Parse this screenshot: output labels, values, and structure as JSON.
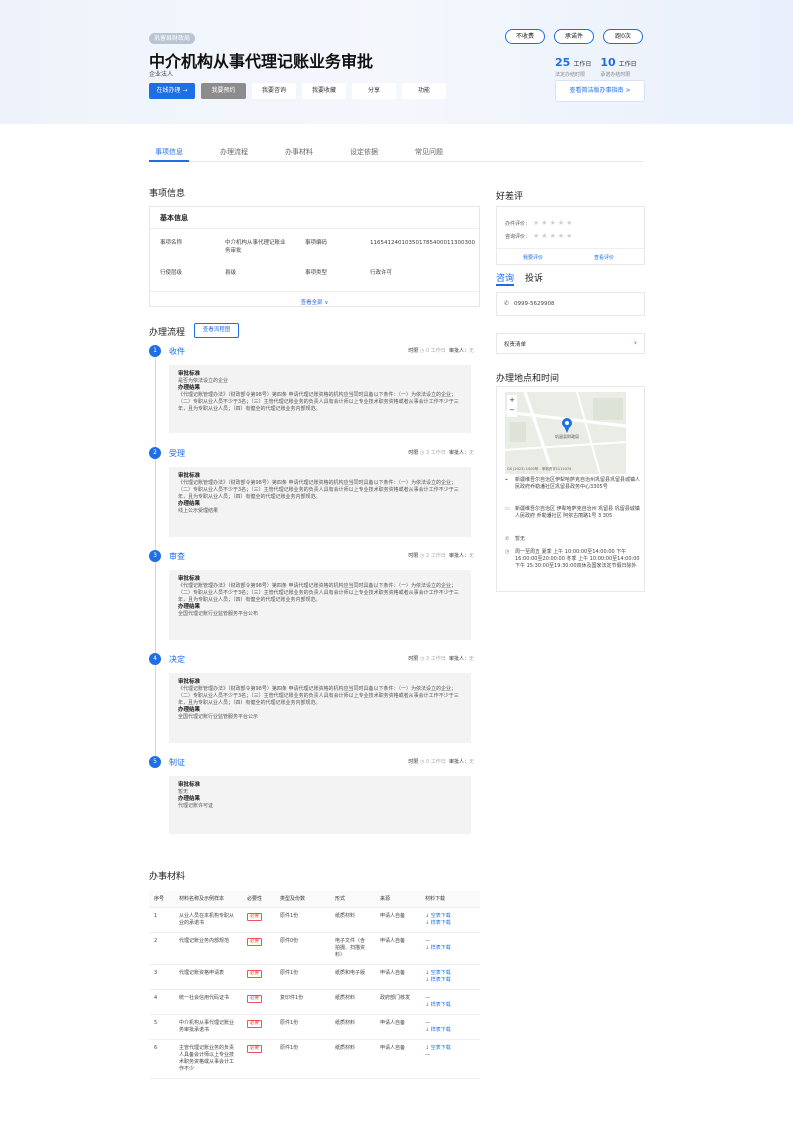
{
  "header": {
    "department": "巩留县财政局",
    "title": "中介机构从事代理记账业务审批",
    "service_object": "企业法人",
    "buttons": [
      "在线办理 →",
      "我要预约",
      "我要咨询",
      "我要收藏",
      "分享",
      "功能"
    ],
    "badges": [
      "不收费",
      "承诺件",
      "跑0次"
    ],
    "stats": [
      {
        "number": "25",
        "unit": "工作日",
        "label": "法定办结时限"
      },
      {
        "number": "10",
        "unit": "工作日",
        "label": "承诺办结时限"
      }
    ],
    "guide_link": "查看简洁版办事指南 >"
  },
  "tabs": [
    "事项信息",
    "办理流程",
    "办事材料",
    "设定依据",
    "常见问题"
  ],
  "item_info": {
    "heading": "事项信息",
    "box_title": "基本信息",
    "rows": [
      {
        "k1": "事项名称",
        "v1": "中介机构从事代理记账业务审批",
        "k2": "事项编码",
        "v2": "116541240103501785400011300300"
      },
      {
        "k1": "行使层级",
        "v1": "县级",
        "k2": "事项类型",
        "v2": "行政许可"
      }
    ],
    "more": "查看全部 ∨"
  },
  "process": {
    "heading": "办理流程",
    "view_chart": "查看流程图",
    "time_label": "时限",
    "approver_label": "审批人：",
    "approver_value": "无",
    "standard_label": "审批标准",
    "result_label": "办理结果",
    "steps": [
      {
        "num": "1",
        "name": "收件",
        "time": "0 工作日",
        "standard": "是否为依法设立的企业",
        "result": "《代理记账管理办法》（财政部令第98号）第四条 申请代理记账资格的机构应当同时具备以下条件：（一）为依法设立的企业；（二）专职从业人员不少于3名；（三）主管代理记账业务的负责人具有会计师以上专业技术职务资格或者从事会计工作不少于三年，且为专职从业人员；（四）有健全的代理记账业务内部规范。"
      },
      {
        "num": "2",
        "name": "受理",
        "time": "3 工作日",
        "standard": "《代理记账管理办法》（财政部令第98号）第四条 申请代理记账资格的机构应当同时具备以下条件：（一）为依法设立的企业；（二）专职从业人员不少于3名；（三）主管代理记账业务的负责人具有会计师以上专业技术职务资格或者从事会计工作不少于三年，且为专职从业人员；（四）有健全的代理记账业务内部规范。",
        "result": "线上公示受理结果"
      },
      {
        "num": "3",
        "name": "审查",
        "time": "2 工作日",
        "standard": "《代理记账管理办法》（财政部令第98号）第四条 申请代理记账资格的机构应当同时具备以下条件：（一）为依法设立的企业；（二）专职从业人员不少于3名；（三）主管代理记账业务的负责人具有会计师以上专业技术职务资格或者从事会计工作不少于三年，且为专职从业人员；（四）有健全的代理记账业务内部规范。",
        "result": "全国代理记账行业监管服务平台公布"
      },
      {
        "num": "4",
        "name": "决定",
        "time": "3 工作日",
        "standard": "《代理记账管理办法》（财政部令第98号）第四条 申请代理记账资格的机构应当同时具备以下条件：（一）为依法设立的企业；（二）专职从业人员不少于3名；（三）主管代理记账业务的负责人具有会计师以上专业技术职务资格或者从事会计工作不少于三年，且为专职从业人员；（四）有健全的代理记账业务内部规范。",
        "result": "全国代理记账行业监管服务平台公示"
      },
      {
        "num": "5",
        "name": "制证",
        "time": "0 工作日",
        "standard": "暂无",
        "result": "代理记账许可证"
      }
    ]
  },
  "sidebar": {
    "rating_title": "好差评",
    "rating_rows": [
      "办件评价：",
      "咨询评价："
    ],
    "rating_links": [
      "我要评价",
      "查看评价"
    ],
    "consult_tab": "咨询",
    "complain_tab": "投诉",
    "phone": "0999-5629908",
    "power_list": "权责清单",
    "place_title": "办理地点和时间",
    "map_label": "巩留县财政局",
    "map_copyright": "GS (2023) 1500号 - 甲测资字1111074",
    "address": "新疆维吾尔自治区伊犁哈萨克自治州巩留县巩留县城镇人民政府乔勒潘社区巩留县政务中心3305号",
    "address2": "新疆维吾尔自治区 伊犁哈萨克自治州 巩留县 巩留县城镇人民政府 乔勒潘社区 阿依古丽路1号 3 305",
    "contact": "暂无",
    "hours": "周一至周五 夏季 上午 10:00:00至14:00:00 下午 16:00:00至20:00:00 冬季 上午 10:00:00至14:00:00 下午 15:30:00至19:30:00双休及国家法定节假日除外"
  },
  "materials": {
    "heading": "办事材料",
    "columns": [
      "序号",
      "材料名称及示例样本",
      "必要性",
      "类型及份数",
      "形式",
      "来源",
      "材料下载"
    ],
    "required_label": "必要",
    "blank_label": "↓ 空表下载",
    "sample_label": "↓ 样表下载",
    "rows": [
      {
        "no": "1",
        "name": "从业人员在本机构专职从业的承诺书",
        "type": "原件1份",
        "form": "纸质材料",
        "source": "申请人自备",
        "blank": true,
        "sample": true
      },
      {
        "no": "2",
        "name": "代理记账业务内部规范",
        "type": "原件0份",
        "form": "电子文件（含拍摄、扫描资料）",
        "source": "申请人自备",
        "blank": false,
        "sample": true
      },
      {
        "no": "3",
        "name": "代理记账资格申请表",
        "type": "原件1份",
        "form": "纸质和电子版",
        "source": "申请人自备",
        "blank": true,
        "sample": true
      },
      {
        "no": "4",
        "name": "统一社会信用代码证书",
        "type": "复印件1份",
        "form": "纸质材料",
        "source": "政府部门核发",
        "blank": false,
        "sample": true
      },
      {
        "no": "5",
        "name": "中介机构从事代理记账业务审批承诺书",
        "type": "原件1份",
        "form": "纸质材料",
        "source": "申请人自备",
        "blank": false,
        "sample": true
      },
      {
        "no": "6",
        "name": "主管代理记账业务的负责人具备会计师以上专业技术职务资格或从事会计工作不少",
        "type": "原件1份",
        "form": "纸质材料",
        "source": "申请人自备",
        "blank": true,
        "sample": false
      }
    ]
  },
  "colors": {
    "primary": "#1e6ee6",
    "required": "#e33333",
    "bg_hero": "#eef3fb"
  }
}
